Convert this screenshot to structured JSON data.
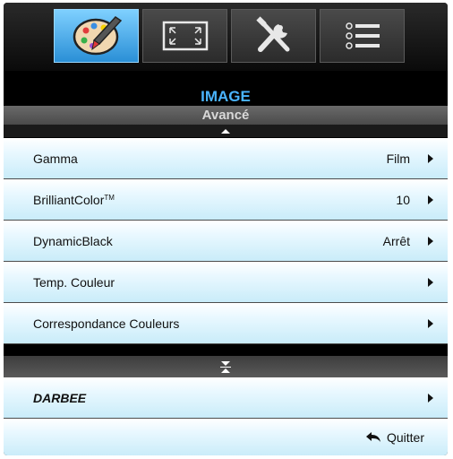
{
  "tabs": [
    {
      "name": "image-tab",
      "icon": "palette-brush-icon",
      "active": true
    },
    {
      "name": "display-tab",
      "icon": "screen-expand-icon",
      "active": false
    },
    {
      "name": "setup-tab",
      "icon": "tools-icon",
      "active": false
    },
    {
      "name": "options-tab",
      "icon": "list-icon",
      "active": false
    }
  ],
  "header": {
    "title": "IMAGE",
    "subtitle": "Avancé"
  },
  "menu": [
    {
      "label": "Gamma",
      "value": "Film"
    },
    {
      "label": "BrilliantColor",
      "label_sup": "TM",
      "value": "10"
    },
    {
      "label": "DynamicBlack",
      "value": "Arrêt"
    },
    {
      "label": "Temp. Couleur",
      "value": ""
    },
    {
      "label": "Correspondance Couleurs",
      "value": ""
    }
  ],
  "darbee": {
    "label": "DARBEE"
  },
  "exit": {
    "label": "Quitter",
    "icon": "return-arrow-icon"
  },
  "colors": {
    "accent": "#4ab4ff",
    "active_tab": "#2a8fd6",
    "row_bg": "#d6f1fb"
  }
}
